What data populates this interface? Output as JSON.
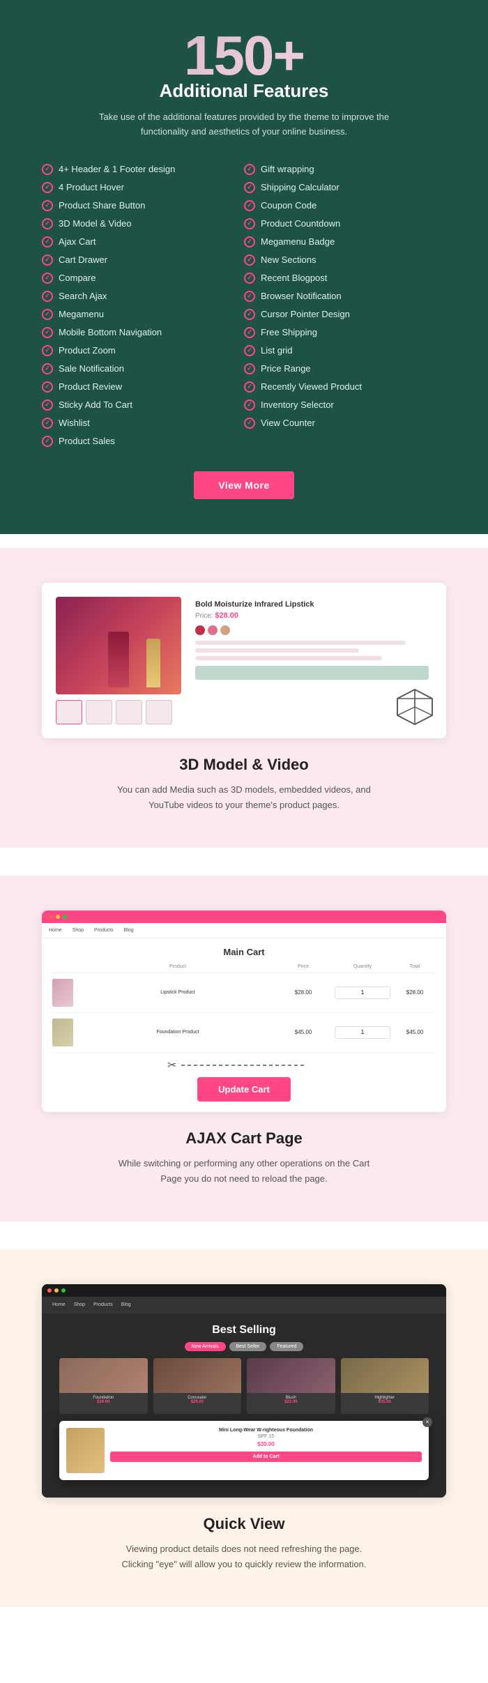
{
  "features": {
    "number": "150+",
    "title": "Additional Features",
    "subtitle": "Take use of the additional features provided by the theme to improve the functionality and aesthetics of your online business.",
    "left_items": [
      "4+ Header & 1 Footer design",
      "4 Product Hover",
      "Product Share Button",
      "3D Model & Video",
      "Ajax Cart",
      "Cart Drawer",
      "Compare",
      "Search Ajax",
      "Megamenu",
      "Mobile Bottom Navigation",
      "Product Zoom",
      "Sale Notification",
      "Product Review",
      "Sticky Add To Cart",
      "Wishlist",
      "Product Sales"
    ],
    "right_items": [
      "Gift wrapping",
      "Shipping Calculator",
      "Coupon Code",
      "Product Countdown",
      "Megamenu Badge",
      "New Sections",
      "Recent Blogpost",
      "Browser Notification",
      "Cursor Pointer Design",
      "Free Shipping",
      "List grid",
      "Price Range",
      "Recently Viewed Product",
      "Inventory Selector",
      "View Counter"
    ],
    "button_label": "View More"
  },
  "model_section": {
    "heading": "3D Model & Video",
    "description": "You can add Media such as 3D models, embedded videos, and YouTube videos to your theme's product pages.",
    "product_title": "Bold Moisturize Infrared Lipstick",
    "product_price": "$28.00"
  },
  "ajax_section": {
    "heading": "AJAX Cart Page",
    "description": "While switching or performing any other operations on the Cart Page you do not need to reload the page.",
    "cart_title": "Main Cart",
    "button_label": "Update Cart",
    "col_headers": [
      "",
      "Product",
      "Price",
      "Quantity",
      "Total"
    ],
    "cart_rows": [
      {
        "name": "Lipstick Product",
        "price": "$28.00",
        "qty": "1",
        "total": "$28.00"
      },
      {
        "name": "Foundation Product",
        "price": "$45.00",
        "qty": "1",
        "total": "$45.00"
      }
    ]
  },
  "quickview_section": {
    "heading": "Quick View",
    "description": "Viewing product details does not need refreshing the page. Clicking \"eye\" will allow you to quickly review the information.",
    "banner_title": "Best Selling",
    "pills": [
      "New Arrivals",
      "Best Seller",
      "Featured"
    ],
    "overlay_title": "Mini Long-Wear W-righteous Foundation",
    "overlay_subtitle": "SPF 15",
    "overlay_price": "$39.00",
    "overlay_button": "Add to Cart"
  },
  "colors": {
    "primary": "#ff4785",
    "dark_green": "#1e5244",
    "pink_bg": "#fce8f0",
    "cream_bg": "#fdf3e8",
    "icon_color": "#ff4785"
  }
}
